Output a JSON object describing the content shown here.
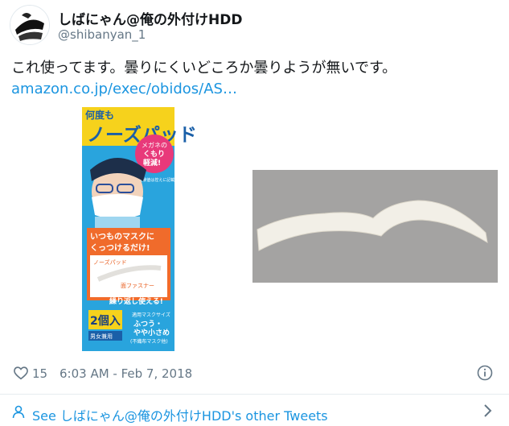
{
  "tweet": {
    "display_name": "しばにゃん@俺の外付けHDD",
    "handle": "@shibanyan_1",
    "text": "これ使ってます。曇りにくいどころか曇りようが無いです。",
    "link": "amazon.co.jp/exec/obidos/AS…",
    "like_count": "15",
    "timestamp": "6:03 AM - Feb 7, 2018"
  },
  "product_package": {
    "title": "ノーズパッド",
    "top_prefix": "何度も",
    "badge_line1": "メガネの",
    "badge_line2": "くもり",
    "badge_line3": "軽減!",
    "small_note": "※実験値は控えに記載",
    "main_copy_line1": "いつものマスクに",
    "main_copy_line2": "くっつけるだけ!",
    "label_pad": "ノーズパッド",
    "label_fastener": "面ファスナー",
    "reuse": "繰り返し使える!",
    "count": "2個入",
    "unisex": "男女兼用",
    "size_label": "適用マスクサイズ",
    "size_value1": "ふつう・",
    "size_value2": "やや小さめ",
    "size_note": "(不織布マスク他)"
  },
  "footer": {
    "see_more": "See しばにゃん@俺の外付けHDD's other Tweets"
  },
  "colors": {
    "link": "#1b95e0",
    "secondary": "#657786",
    "package_blue": "#29a4dd",
    "package_yellow": "#f6d21c",
    "pad_gray": "#a4a3a2"
  },
  "icons": [
    "avatar-image",
    "heart-icon",
    "info-icon",
    "person-icon",
    "chevron-right-icon"
  ]
}
